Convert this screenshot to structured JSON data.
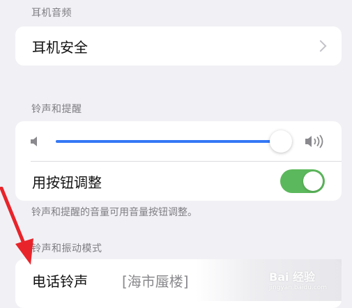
{
  "sections": {
    "headphone_audio": {
      "header": "耳机音频",
      "item_label": "耳机安全"
    },
    "ringer_alerts": {
      "header": "铃声和提醒",
      "slider": {
        "value_fraction": 0.99
      },
      "toggle_label": "用按钮调整",
      "toggle_on": true,
      "footnote": "铃声和提醒的音量可用音量按钮调整。"
    },
    "sound_haptic": {
      "header": "铃声和振动模式",
      "ringtone_label": "电话铃声",
      "ringtone_value": "[海市蜃楼]"
    }
  },
  "watermark": {
    "text": "Bai 经验",
    "sub": "jingyan.baidu.com"
  },
  "colors": {
    "accent_blue": "#3478f6",
    "toggle_green": "#5cb85c",
    "arrow_red": "#e8242a",
    "background": "#f1f1f5",
    "secondary_text": "#7d7d82"
  },
  "icons": {
    "volume_low": "speaker-low-icon",
    "volume_high": "speaker-high-icon",
    "chevron": "chevron-right-icon"
  }
}
